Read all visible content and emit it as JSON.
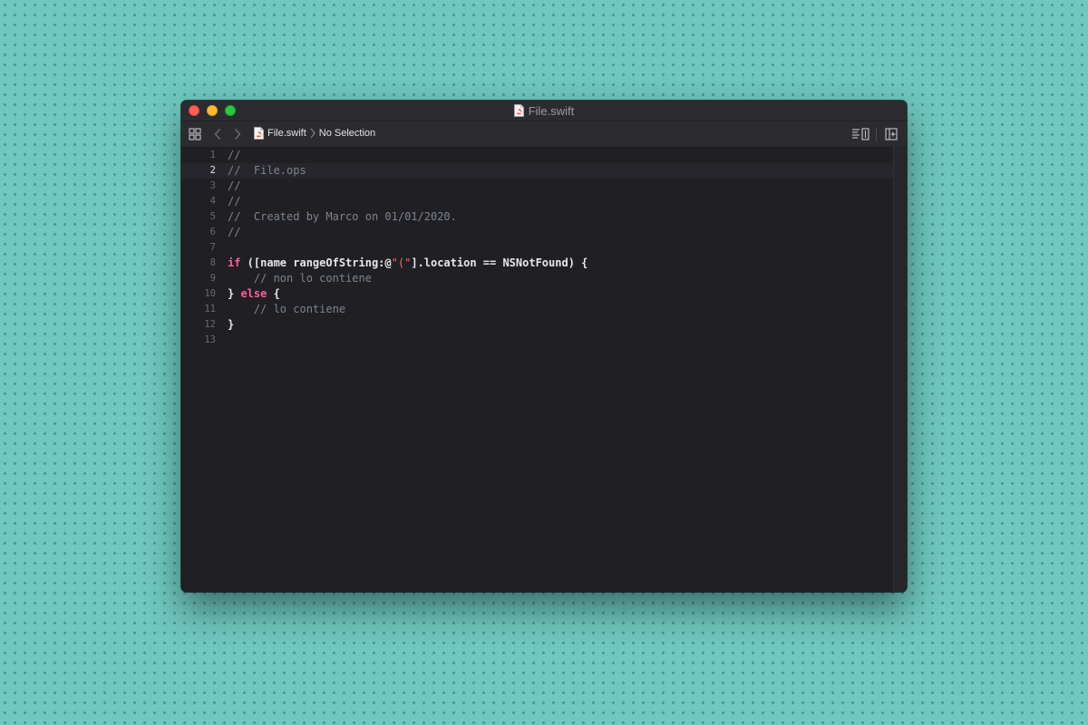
{
  "window": {
    "title": "File.swift"
  },
  "toolbar": {
    "breadcrumb_file": "File.swift",
    "breadcrumb_selection": "No Selection"
  },
  "icons": {
    "close": "close-button-red",
    "minimize": "minimize-button-yellow",
    "maximize": "zoom-button-green",
    "grid": "related-items-grid-icon",
    "back": "chevron-left-icon",
    "forward": "chevron-right-icon",
    "file": "swift-file-icon",
    "editor_options": "editor-options-icon",
    "add_editor": "add-editor-icon"
  },
  "colors": {
    "background": "#6fc7bf",
    "editor_bg": "#1f1f24",
    "comment": "#7d8590",
    "keyword": "#fc5fa3",
    "string": "#fc6a5d"
  },
  "editor": {
    "current_line": 2,
    "lines": [
      {
        "n": "1",
        "tokens": [
          {
            "t": "//",
            "c": "cmt"
          }
        ]
      },
      {
        "n": "2",
        "tokens": [
          {
            "t": "//  File.ops",
            "c": "cmt"
          }
        ]
      },
      {
        "n": "3",
        "tokens": [
          {
            "t": "//",
            "c": "cmt"
          }
        ]
      },
      {
        "n": "4",
        "tokens": [
          {
            "t": "//",
            "c": "cmt"
          }
        ]
      },
      {
        "n": "5",
        "tokens": [
          {
            "t": "//  Created by Marco on 01/01/2020.",
            "c": "cmt"
          }
        ]
      },
      {
        "n": "6",
        "tokens": [
          {
            "t": "//",
            "c": "cmt"
          }
        ]
      },
      {
        "n": "7",
        "tokens": []
      },
      {
        "n": "8",
        "tokens": [
          {
            "t": "if",
            "c": "kw"
          },
          {
            "t": " ([name rangeOfString:@",
            "c": "plain"
          },
          {
            "t": "\"(\"",
            "c": "str"
          },
          {
            "t": "].location == NSNotFound) {",
            "c": "plain"
          }
        ]
      },
      {
        "n": "9",
        "tokens": [
          {
            "t": "    // non lo contiene",
            "c": "cmt"
          }
        ]
      },
      {
        "n": "10",
        "tokens": [
          {
            "t": "} ",
            "c": "plain"
          },
          {
            "t": "else",
            "c": "kw"
          },
          {
            "t": " {",
            "c": "plain"
          }
        ]
      },
      {
        "n": "11",
        "tokens": [
          {
            "t": "    // lo contiene",
            "c": "cmt"
          }
        ]
      },
      {
        "n": "12",
        "tokens": [
          {
            "t": "}",
            "c": "plain"
          }
        ]
      },
      {
        "n": "13",
        "tokens": []
      }
    ]
  }
}
